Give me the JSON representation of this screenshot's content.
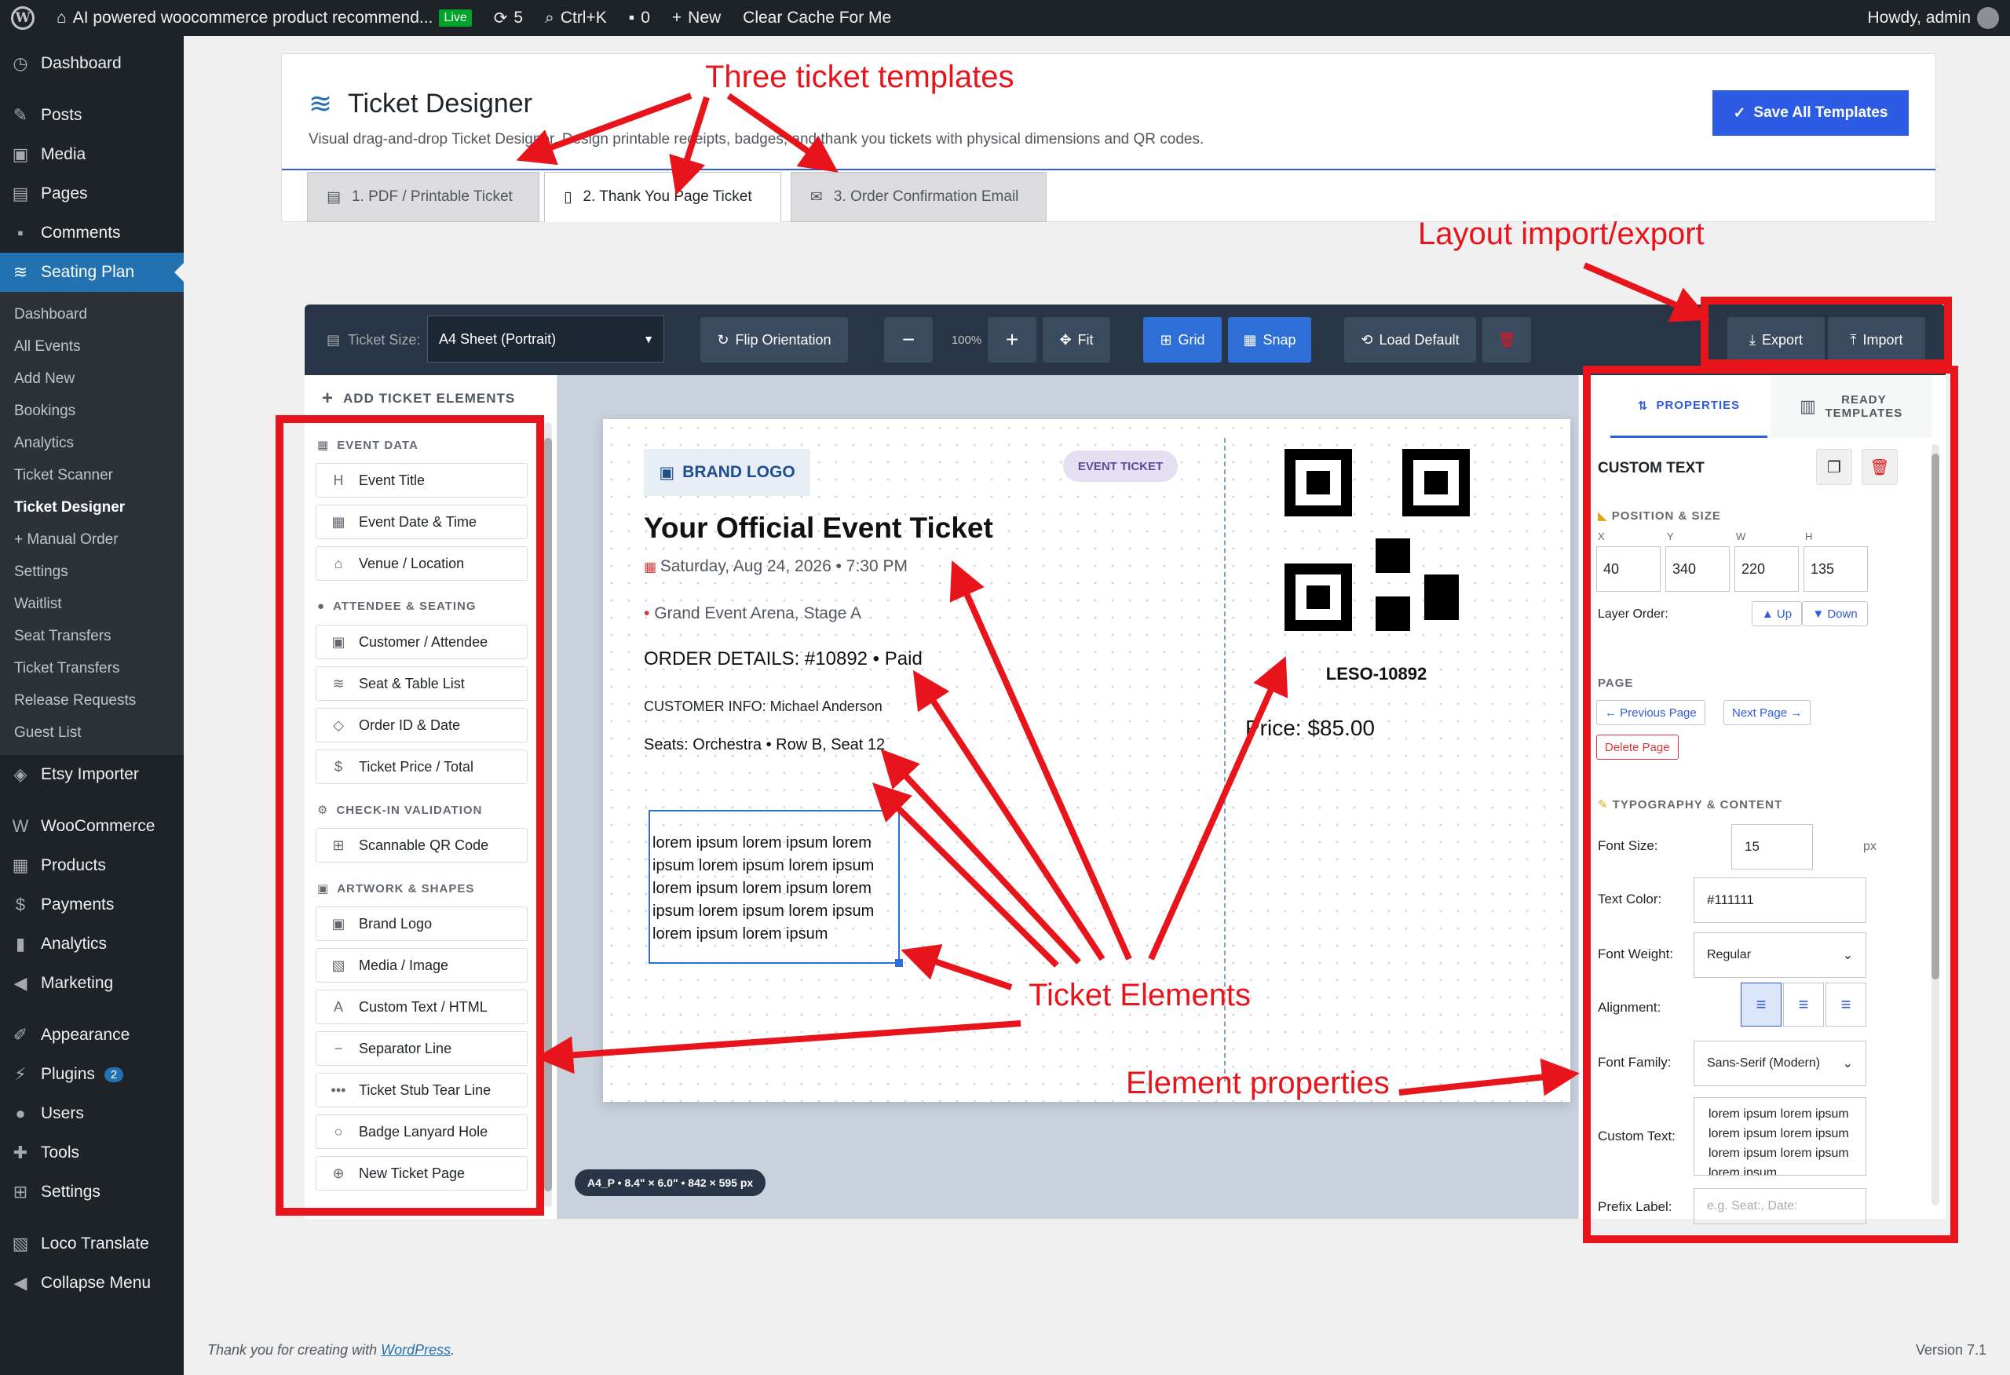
{
  "adminbar": {
    "site_name": "AI powered woocommerce product recommend...",
    "live_badge": "Live",
    "updates_count": "5",
    "search_label": "Ctrl+K",
    "comments_count": "0",
    "new_label": "New",
    "clear_cache": "Clear Cache For Me",
    "howdy": "Howdy, admin"
  },
  "sidebar": {
    "top_items": [
      {
        "label": "Dashboard",
        "icon": "dashboard-icon"
      },
      {
        "label": "Posts",
        "icon": "pin-icon"
      },
      {
        "label": "Media",
        "icon": "media-icon"
      },
      {
        "label": "Pages",
        "icon": "pages-icon"
      },
      {
        "label": "Comments",
        "icon": "comments-icon"
      },
      {
        "label": "Seating Plan",
        "icon": "tickets-icon"
      }
    ],
    "submenu": [
      "Dashboard",
      "All Events",
      "Add New",
      "Bookings",
      "Analytics",
      "Ticket Scanner",
      "Ticket Designer",
      "+ Manual Order",
      "Settings",
      "Waitlist",
      "Seat Transfers",
      "Ticket Transfers",
      "Release Requests",
      "Guest List"
    ],
    "bottom_items": [
      {
        "label": "Etsy Importer"
      },
      {
        "label": "WooCommerce"
      },
      {
        "label": "Products"
      },
      {
        "label": "Payments"
      },
      {
        "label": "Analytics"
      },
      {
        "label": "Marketing"
      },
      {
        "label": "Appearance"
      },
      {
        "label": "Plugins",
        "badge": "2"
      },
      {
        "label": "Users"
      },
      {
        "label": "Tools"
      },
      {
        "label": "Settings"
      },
      {
        "label": "Loco Translate"
      },
      {
        "label": "Collapse Menu"
      }
    ]
  },
  "header": {
    "title": "Ticket Designer",
    "subtitle": "Visual drag-and-drop Ticket Designer. Design printable receipts, badges, and thank you tickets with physical dimensions and QR codes.",
    "save_button": "Save All Templates",
    "tabs": [
      "1. PDF / Printable Ticket",
      "2. Thank You Page Ticket",
      "3. Order Confirmation Email"
    ]
  },
  "toolbar": {
    "ticket_size_label": "Ticket Size:",
    "ticket_size_value": "A4 Sheet (Portrait)",
    "flip": "Flip Orientation",
    "zoom": "100%",
    "fit": "Fit",
    "grid": "Grid",
    "snap": "Snap",
    "load_default": "Load Default",
    "export": "Export",
    "import": "Import"
  },
  "left_panel": {
    "title": "ADD TICKET ELEMENTS",
    "categories": [
      {
        "name": "EVENT DATA",
        "items": [
          "Event Title",
          "Event Date & Time",
          "Venue / Location"
        ]
      },
      {
        "name": "ATTENDEE & SEATING",
        "items": [
          "Customer / Attendee",
          "Seat & Table List",
          "Order ID & Date",
          "Ticket Price / Total"
        ]
      },
      {
        "name": "CHECK-IN VALIDATION",
        "items": [
          "Scannable QR Code"
        ]
      },
      {
        "name": "ARTWORK & SHAPES",
        "items": [
          "Brand Logo",
          "Media / Image",
          "Custom Text / HTML",
          "Separator Line",
          "Ticket Stub Tear Line",
          "Badge Lanyard Hole",
          "New Ticket Page"
        ]
      }
    ]
  },
  "ticket": {
    "brand_logo": "BRAND LOGO",
    "badge": "EVENT TICKET",
    "title": "Your Official Event Ticket",
    "date": "Saturday, Aug 24, 2026 • 7:30 PM",
    "venue": "Grand Event Arena, Stage A",
    "order": "ORDER DETAILS: #10892 • Paid",
    "customer": "CUSTOMER INFO: Michael Anderson",
    "seats": "Seats: Orchestra • Row B, Seat 12",
    "lorem": "lorem ipsum lorem ipsum lorem ipsum lorem ipsum lorem ipsum lorem ipsum lorem ipsum lorem ipsum lorem ipsum lorem ipsum lorem ipsum lorem ipsum",
    "code": "LESO-10892",
    "price": "Price: $85.00",
    "canvas_info": "A4_P • 8.4\" × 6.0\" • 842 × 595 px"
  },
  "right_panel": {
    "tab_properties": "PROPERTIES",
    "tab_ready": "READY TEMPLATES",
    "element_title": "CUSTOM TEXT",
    "position_size": "POSITION & SIZE",
    "x_label": "X",
    "y_label": "Y",
    "w_label": "W",
    "h_label": "H",
    "x": "40",
    "y": "340",
    "w": "220",
    "h": "135",
    "layer_order": "Layer Order:",
    "up": "▲ Up",
    "down": "▼ Down",
    "page_section": "PAGE",
    "prev_page": "← Previous Page",
    "next_page": "Next Page →",
    "delete_page": "Delete Page",
    "typography": "TYPOGRAPHY & CONTENT",
    "font_size_label": "Font Size:",
    "font_size": "15",
    "px": "px",
    "text_color_label": "Text Color:",
    "text_color": "#111111",
    "font_weight_label": "Font Weight:",
    "font_weight": "Regular",
    "alignment_label": "Alignment:",
    "font_family_label": "Font Family:",
    "font_family": "Sans-Serif (Modern)",
    "custom_text_label": "Custom Text:",
    "custom_text": "lorem ipsum lorem ipsum lorem ipsum lorem ipsum lorem ipsum lorem ipsum lorem ipsum",
    "prefix_label": "Prefix Label:",
    "prefix_placeholder": "e.g. Seat:, Date:"
  },
  "footer": {
    "thanks": "Thank you for creating with",
    "wordpress": "WordPress",
    "version": "Version 7.1"
  },
  "annotations": {
    "templates": "Three ticket templates",
    "layout": "Layout import/export",
    "elements": "Ticket Elements",
    "properties": "Element properties"
  },
  "colors": {
    "annotation": "#e8141b",
    "accent": "#2d5be3",
    "toolbar": "#283547",
    "admin": "#1d2327"
  }
}
